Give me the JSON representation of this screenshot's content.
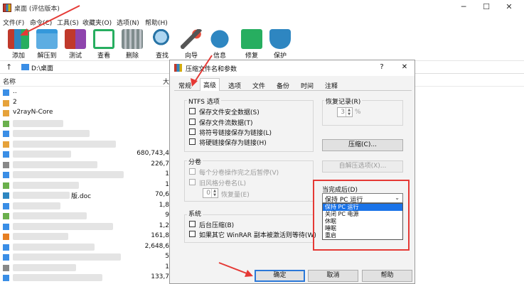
{
  "window": {
    "title": "桌面 (评估版本)"
  },
  "menu": [
    "文件(F)",
    "命令(C)",
    "工具(S)",
    "收藏夹(O)",
    "选项(N)",
    "帮助(H)"
  ],
  "toolbar": [
    {
      "label": "添加",
      "icon": "add-archive-icon",
      "color": "#c0392b"
    },
    {
      "label": "解压到",
      "icon": "extract-folder-icon",
      "color": "#5dade2"
    },
    {
      "label": "测试",
      "icon": "test-icon",
      "color": "#c0392b"
    },
    {
      "label": "查看",
      "icon": "view-book-icon",
      "color": "#27ae60"
    },
    {
      "label": "删除",
      "icon": "trash-icon",
      "color": "#7f8c8d"
    },
    {
      "label": "查找",
      "icon": "search-icon",
      "color": "#2874a6"
    },
    {
      "label": "向导",
      "icon": "wizard-wand-icon",
      "color": "#e74c3c"
    },
    {
      "label": "信息",
      "icon": "info-icon",
      "color": "#2e86c1"
    },
    {
      "label": "修复",
      "icon": "repair-icon",
      "color": "#27ae60"
    },
    {
      "label": "保护",
      "icon": "shield-icon",
      "color": "#2e86c1"
    }
  ],
  "address": {
    "path": "D:\\桌面"
  },
  "list": {
    "headers": {
      "name": "名称",
      "size": "大"
    },
    "rows": [
      {
        "name": "..",
        "size": ""
      },
      {
        "name": "2",
        "size": ""
      },
      {
        "name": "v2rayN-Core",
        "size": ""
      },
      {
        "name": "",
        "size": ""
      },
      {
        "name": "",
        "size": ""
      },
      {
        "name": "",
        "size": ""
      },
      {
        "name": "",
        "size": "680,743,4"
      },
      {
        "name": "",
        "size": "226,7"
      },
      {
        "name": "",
        "size": "1"
      },
      {
        "name": "",
        "size": "1"
      },
      {
        "name": "版.doc",
        "size": "70,6"
      },
      {
        "name": "",
        "size": "1,8"
      },
      {
        "name": "",
        "size": "9"
      },
      {
        "name": "",
        "size": "1,2"
      },
      {
        "name": "",
        "size": "161,8"
      },
      {
        "name": "",
        "size": "2,648,6"
      },
      {
        "name": "",
        "size": "5"
      },
      {
        "name": "",
        "size": "1"
      },
      {
        "name": "",
        "size": "133,7"
      },
      {
        "name": "",
        "size": "1"
      }
    ]
  },
  "dialog": {
    "title": "压缩文件名和参数",
    "tabs": [
      "常规",
      "高级",
      "选项",
      "文件",
      "备份",
      "时间",
      "注释"
    ],
    "active_tab": "高级",
    "ntfs": {
      "title": "NTFS 选项",
      "items": [
        "保存文件安全数据(S)",
        "保存文件流数据(T)",
        "将符号链接保存为链接(L)",
        "将硬链接保存为链接(H)"
      ]
    },
    "volume": {
      "title": "分卷",
      "items": [
        "每个分卷操作完之后暂停(V)",
        "旧风格分卷名(L)"
      ],
      "spin_value": "0",
      "spin_label": "恢复量(E)"
    },
    "system": {
      "title": "系统",
      "items": [
        "后台压缩(B)",
        "如果其它 WinRAR 副本被激活则等待(W)"
      ]
    },
    "recovery": {
      "title": "恢复记录(R)",
      "value": "3",
      "unit": "%"
    },
    "compress_button": "压缩(C)...",
    "sfx_button": "自解压选项(X)...",
    "after": {
      "title": "当完成后(D)",
      "selected": "保持 PC 运行",
      "options": [
        "保持 PC 运行",
        "关闭 PC 电源",
        "休眠",
        "睡眠",
        "重启"
      ]
    },
    "ok": "确定",
    "cancel": "取消",
    "help": "帮助"
  }
}
